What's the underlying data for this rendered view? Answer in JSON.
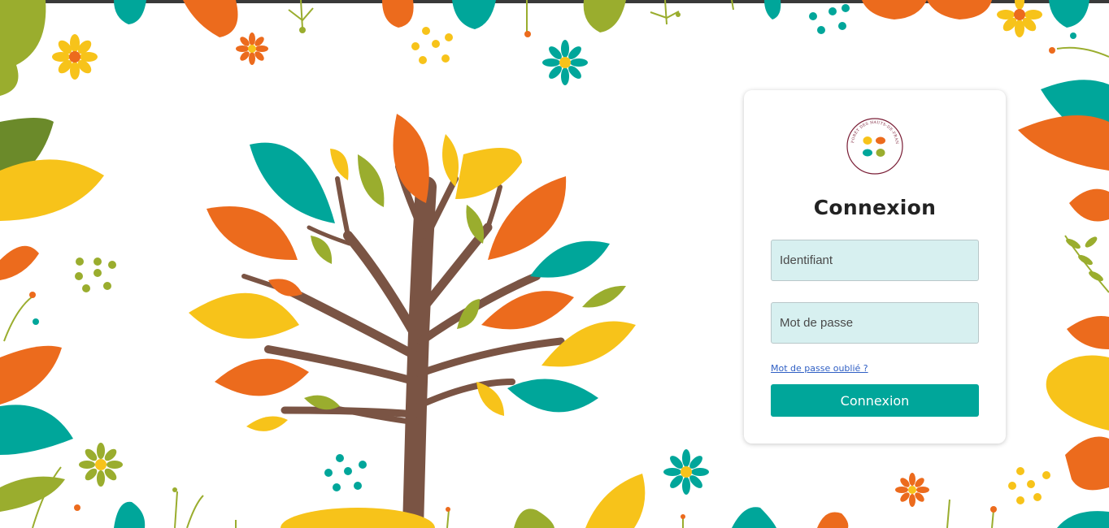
{
  "logo": {
    "text": "LA FORÊT DES HAUTS-DE-FRANCE"
  },
  "login": {
    "title": "Connexion",
    "username_placeholder": "Identifiant",
    "password_placeholder": "Mot de passe",
    "forgot_label": "Mot de passe oublié ?",
    "submit_label": "Connexion"
  },
  "colors": {
    "teal": "#00a69a",
    "orange": "#ec6b1d",
    "yellow": "#f7c31a",
    "olive": "#9aad2e",
    "brown": "#7a5444",
    "field_bg": "#d7f0f0"
  }
}
